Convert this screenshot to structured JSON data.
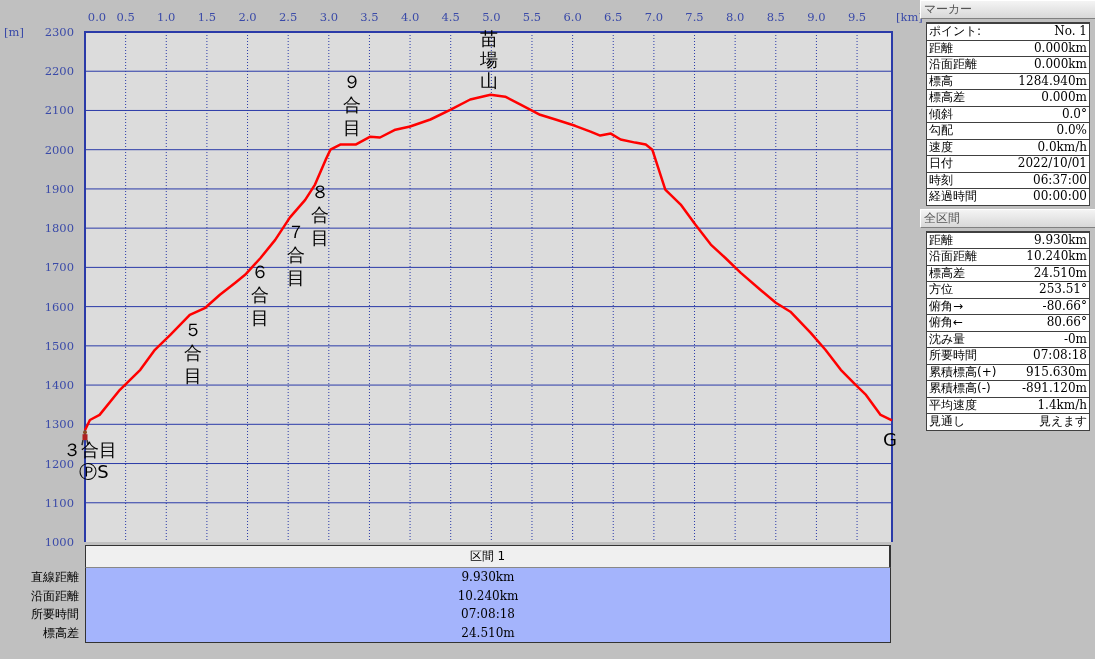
{
  "chart": {
    "chart_data": {
      "type": "line",
      "xlabel": "[km]",
      "ylabel": "[m]",
      "xlim": [
        0,
        9.93
      ],
      "ylim": [
        1000,
        2300
      ],
      "xticks": [
        {
          "value": 0,
          "label": "0.0"
        },
        {
          "value": 0.5,
          "label": "0.5"
        },
        {
          "value": 1,
          "label": "1.0"
        },
        {
          "value": 1.5,
          "label": "1.5"
        },
        {
          "value": 2,
          "label": "2.0"
        },
        {
          "value": 2.5,
          "label": "2.5"
        },
        {
          "value": 3,
          "label": "3.0"
        },
        {
          "value": 3.5,
          "label": "3.5"
        },
        {
          "value": 4,
          "label": "4.0"
        },
        {
          "value": 4.5,
          "label": "4.5"
        },
        {
          "value": 5,
          "label": "5.0"
        },
        {
          "value": 5.5,
          "label": "5.5"
        },
        {
          "value": 6,
          "label": "6.0"
        },
        {
          "value": 6.5,
          "label": "6.5"
        },
        {
          "value": 7,
          "label": "7.0"
        },
        {
          "value": 7.5,
          "label": "7.5"
        },
        {
          "value": 8,
          "label": "8.0"
        },
        {
          "value": 8.5,
          "label": "8.5"
        },
        {
          "value": 9,
          "label": "9.0"
        },
        {
          "value": 9.5,
          "label": "9.5"
        }
      ],
      "yticks": [
        1000,
        1100,
        1200,
        1300,
        1400,
        1500,
        1600,
        1700,
        1800,
        1900,
        2000,
        2100,
        2200,
        2300
      ],
      "x": [
        0,
        0.06,
        0.18,
        0.43,
        0.68,
        0.86,
        1.05,
        1.29,
        1.48,
        1.66,
        1.85,
        1.97,
        2.16,
        2.34,
        2.52,
        2.71,
        2.83,
        2.96,
        3.02,
        3.14,
        3.33,
        3.51,
        3.63,
        3.82,
        4.0,
        4.25,
        4.5,
        4.74,
        4.99,
        5.17,
        5.36,
        5.6,
        5.79,
        6.03,
        6.22,
        6.34,
        6.47,
        6.59,
        6.77,
        6.9,
        6.98,
        7.14,
        7.33,
        7.51,
        7.7,
        7.88,
        8.07,
        8.31,
        8.5,
        8.68,
        8.93,
        9.11,
        9.3,
        9.48,
        9.61,
        9.79,
        9.93
      ],
      "grid": true,
      "series": [
        {
          "color": "#ff0000",
          "values": [
            1285,
            1311,
            1324,
            1388,
            1439,
            1490,
            1528,
            1579,
            1597,
            1630,
            1661,
            1681,
            1724,
            1770,
            1827,
            1872,
            1911,
            1974,
            2000,
            2013,
            2013,
            2033,
            2031,
            2051,
            2059,
            2077,
            2102,
            2128,
            2140,
            2135,
            2115,
            2089,
            2077,
            2061,
            2046,
            2036,
            2041,
            2026,
            2018,
            2013,
            2000,
            1898,
            1860,
            1809,
            1758,
            1724,
            1686,
            1643,
            1610,
            1587,
            1533,
            1490,
            1439,
            1401,
            1375,
            1324,
            1310
          ]
        }
      ],
      "annotations": [
        "３合目",
        "ⓅS",
        "５合目",
        "６合目",
        "７合目",
        "８合目",
        "９合目",
        "苗場山",
        "G"
      ]
    }
  },
  "section_table": {
    "header": "区間 1",
    "rows": [
      {
        "label": "直線距離",
        "value": "9.930km"
      },
      {
        "label": "沿面距離",
        "value": "10.240km"
      },
      {
        "label": "所要時間",
        "value": "07:08:18"
      },
      {
        "label": "標高差",
        "value": "24.510m"
      }
    ]
  },
  "marker_panel": {
    "title": "マーカー",
    "rows": [
      {
        "label": "ポイント:",
        "value": "No. 1"
      },
      {
        "label": "距離",
        "value": "0.000km"
      },
      {
        "label": "沿面距離",
        "value": "0.000km"
      },
      {
        "label": "標高",
        "value": "1284.940m"
      },
      {
        "label": "標高差",
        "value": "0.000m"
      },
      {
        "label": "傾斜",
        "value": "0.0°"
      },
      {
        "label": "勾配",
        "value": "0.0%"
      },
      {
        "label": "速度",
        "value": "0.0km/h"
      },
      {
        "label": "日付",
        "value": "2022/10/01"
      },
      {
        "label": "時刻",
        "value": "06:37:00"
      },
      {
        "label": "経過時間",
        "value": "00:00:00"
      }
    ]
  },
  "total_panel": {
    "title": "全区間",
    "rows": [
      {
        "label": "距離",
        "value": "9.930km"
      },
      {
        "label": "沿面距離",
        "value": "10.240km"
      },
      {
        "label": "標高差",
        "value": "24.510m"
      },
      {
        "label": "方位",
        "value": "253.51°"
      },
      {
        "label": "俯角→",
        "value": "-80.66°"
      },
      {
        "label": "俯角←",
        "value": "80.66°"
      },
      {
        "label": "沈み量",
        "value": "-0m"
      },
      {
        "label": "所要時間",
        "value": "07:08:18"
      },
      {
        "label": "累積標高(+)",
        "value": "915.630m"
      },
      {
        "label": "累積標高(-)",
        "value": "-891.120m"
      },
      {
        "label": "平均速度",
        "value": "1.4km/h"
      },
      {
        "label": "見通し",
        "value": "見えます"
      }
    ]
  }
}
